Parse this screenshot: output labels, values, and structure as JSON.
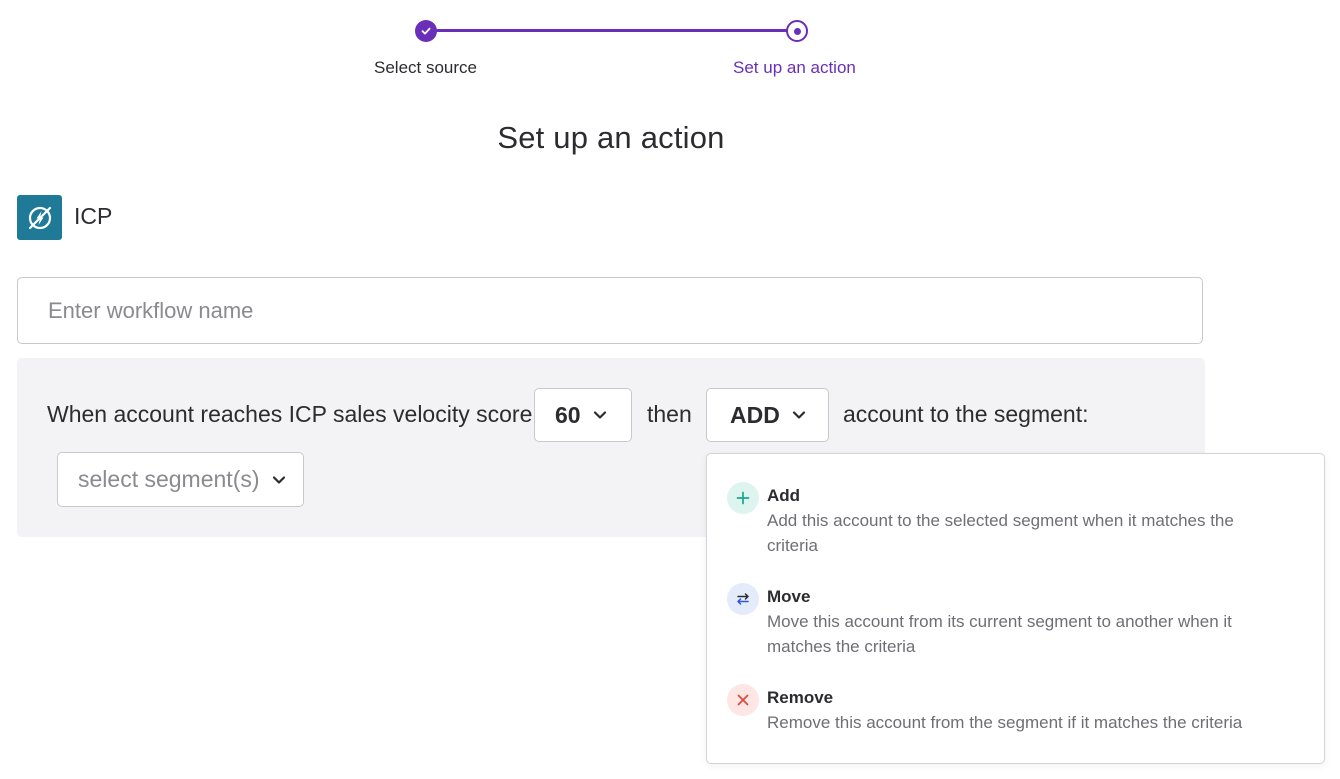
{
  "stepper": {
    "steps": [
      {
        "label": "Select source",
        "status": "done"
      },
      {
        "label": "Set up an action",
        "status": "current"
      }
    ]
  },
  "page": {
    "title": "Set up an action"
  },
  "source": {
    "name": "ICP",
    "logo_icon": "no-power-icon"
  },
  "workflow": {
    "name_value": "",
    "name_placeholder": "Enter workflow name"
  },
  "rule": {
    "prefix": "When account reaches ICP sales velocity score",
    "score_value": "60",
    "connector": "then",
    "action_value": "ADD",
    "suffix": "account to the segment:",
    "segment_placeholder": "select segment(s)"
  },
  "action_menu": {
    "options": [
      {
        "title": "Add",
        "description": "Add this account to the selected segment when it matches the criteria",
        "icon": "plus-icon",
        "color": "#1aa68a"
      },
      {
        "title": "Move",
        "description": "Move this account from its current segment to another when it matches the criteria",
        "icon": "swap-arrows-icon",
        "color": "#2d5bd6"
      },
      {
        "title": "Remove",
        "description": "Remove this account from the segment if it matches the criteria",
        "icon": "close-icon",
        "color": "#e0483e"
      }
    ]
  },
  "colors": {
    "accent": "#6a2fb8",
    "logo_bg": "#1f7a97",
    "panel_bg": "#f3f3f6"
  }
}
